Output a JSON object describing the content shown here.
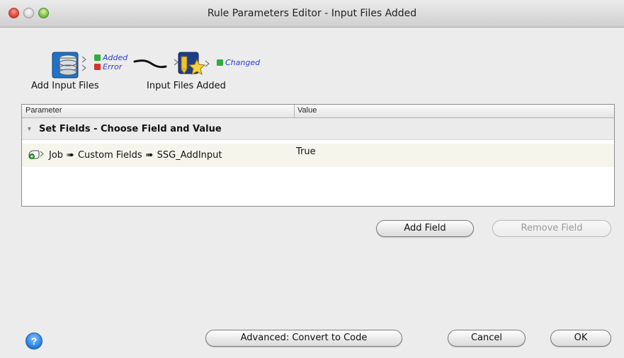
{
  "window": {
    "title": "Rule Parameters Editor - Input Files Added"
  },
  "flow": {
    "source_label": "Add Input Files",
    "source_icon": "database-icon",
    "source_status": [
      {
        "label": "Added",
        "state": "ok"
      },
      {
        "label": "Error",
        "state": "error"
      }
    ],
    "target_label": "Input Files Added",
    "target_icon": "document-star-icon",
    "target_status": [
      {
        "label": "Changed",
        "state": "ok"
      }
    ]
  },
  "table": {
    "columns": [
      "Parameter",
      "Value"
    ],
    "group": "Set Fields - Choose Field and Value",
    "row": {
      "path": [
        "Job",
        "Custom Fields",
        "SSG_AddInput"
      ],
      "value": "True"
    }
  },
  "buttons": {
    "add_field": "Add Field",
    "remove_field": "Remove Field",
    "convert": "Advanced: Convert to Code",
    "cancel": "Cancel",
    "ok": "OK",
    "help": "?"
  },
  "colors": {
    "status_ok": "#2fae3b",
    "status_error": "#d93232",
    "status_text": "#2a3fd0",
    "row_highlight": "#f6f5ec"
  }
}
